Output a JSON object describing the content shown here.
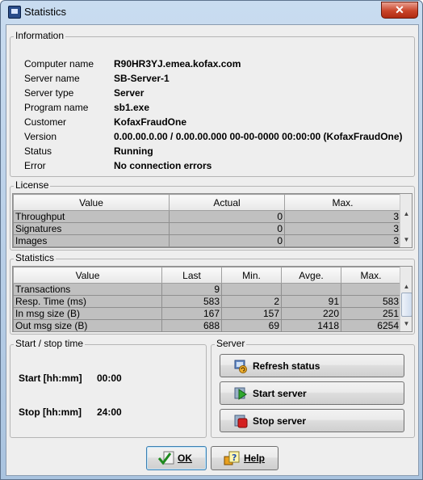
{
  "window": {
    "title": "Statistics",
    "close_glyph": "✕"
  },
  "information": {
    "title": "Information",
    "rows": [
      {
        "label": "Computer name",
        "value": "R90HR3YJ.emea.kofax.com"
      },
      {
        "label": "Server name",
        "value": "SB-Server-1"
      },
      {
        "label": "Server type",
        "value": "Server"
      },
      {
        "label": "Program name",
        "value": "sb1.exe"
      },
      {
        "label": "Customer",
        "value": "KofaxFraudOne"
      },
      {
        "label": "Version",
        "value": "0.00.00.0.00 / 0.00.00.000  00-00-0000  00:00:00 (KofaxFraudOne)"
      },
      {
        "label": "Status",
        "value": "Running"
      },
      {
        "label": "Error",
        "value": "No connection errors"
      }
    ]
  },
  "license": {
    "title": "License",
    "columns": [
      "Value",
      "Actual",
      "Max."
    ],
    "rows": [
      [
        "Throughput",
        "0",
        "3"
      ],
      [
        "Signatures",
        "0",
        "3"
      ],
      [
        "Images",
        "0",
        "3"
      ]
    ]
  },
  "statistics": {
    "title": "Statistics",
    "columns": [
      "Value",
      "Last",
      "Min.",
      "Avge.",
      "Max."
    ],
    "rows": [
      [
        "Transactions",
        "9",
        "",
        "",
        ""
      ],
      [
        "Resp. Time (ms)",
        "583",
        "2",
        "91",
        "583"
      ],
      [
        "In msg size (B)",
        "167",
        "157",
        "220",
        "251"
      ],
      [
        "Out msg size (B)",
        "688",
        "69",
        "1418",
        "6254"
      ]
    ]
  },
  "start_stop": {
    "title": "Start / stop time",
    "start_label": "Start [hh:mm]",
    "start_value": "00:00",
    "stop_label": "Stop [hh:mm]",
    "stop_value": "24:00"
  },
  "server": {
    "title": "Server",
    "refresh_label": "Refresh status",
    "start_label": "Start server",
    "stop_label": "Stop server"
  },
  "dialog": {
    "ok_label": "OK",
    "help_label": "Help"
  }
}
